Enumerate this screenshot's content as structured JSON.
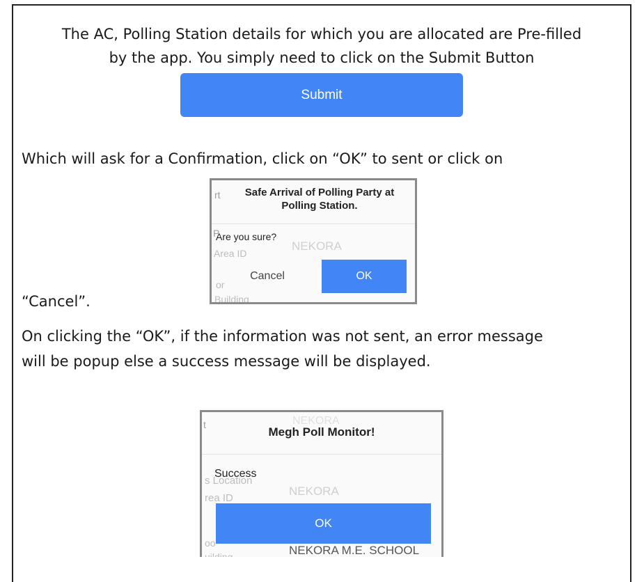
{
  "intro": {
    "line1": "The AC, Polling Station details for which you are allocated are Pre-filled",
    "line2": "by the app. You simply need to click on the Submit Button"
  },
  "submit_button": {
    "label": "Submit",
    "color": "#4285f4"
  },
  "confirm_text": {
    "line1": "Which will ask for a Confirmation, click on “OK” to sent or click on",
    "line2": "“Cancel”."
  },
  "confirm_dialog": {
    "title_line1": "Safe Arrival of Polling Party at",
    "title_line2": "Polling Station.",
    "message": "Are you sure?",
    "cancel_label": "Cancel",
    "ok_label": "OK",
    "background_fragments": [
      "rt",
      "P",
      "Area ID",
      "NEKORA",
      "or",
      "Building"
    ]
  },
  "result_text": {
    "line1": "On clicking the “OK”, if the information was not sent, an error message",
    "line2": "will be popup else a success message will be displayed."
  },
  "result_dialog": {
    "title": "Megh Poll Monitor!",
    "message": "Success",
    "ok_label": "OK",
    "background_fragments": [
      "t",
      "NEKORA",
      "s Location",
      "rea ID",
      "NEKORA",
      "oo",
      "uilding",
      "NEKORA M.E. SCHOOL"
    ]
  }
}
